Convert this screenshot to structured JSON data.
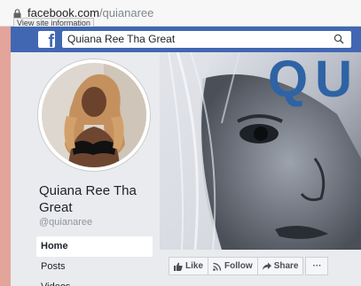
{
  "browser": {
    "url_domain": "facebook.com",
    "url_path": "/quianaree",
    "tooltip": "View site information"
  },
  "fb": {
    "logo_letter": "f",
    "search_value": "Quiana Ree Tha Great"
  },
  "profile": {
    "name": "Quiana Ree Tha Great",
    "username": "@quianaree"
  },
  "nav": {
    "items": [
      {
        "label": "Home"
      },
      {
        "label": "Posts"
      },
      {
        "label": "Videos"
      }
    ]
  },
  "cover": {
    "text": "QUI"
  },
  "actions": {
    "like": "Like",
    "follow": "Follow",
    "share": "Share",
    "more": "···"
  },
  "colors": {
    "fb_blue": "#4267b2",
    "cover_text": "#2e63a5"
  }
}
